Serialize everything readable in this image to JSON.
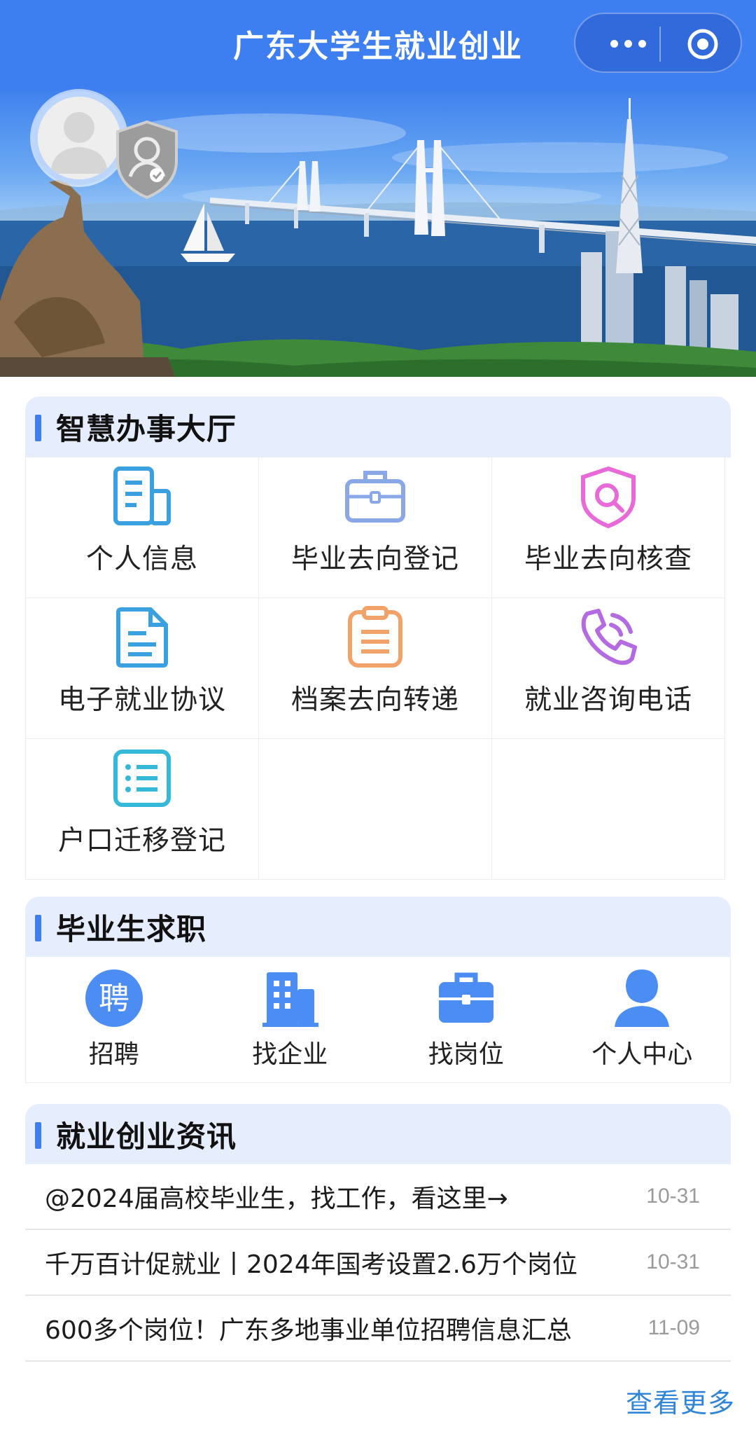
{
  "header": {
    "title": "广东大学生就业创业"
  },
  "colors": {
    "primary": "#3d7ff0",
    "section_bg": "#e6eefe",
    "link": "#2f86d8",
    "date": "#9a9a9a"
  },
  "services": {
    "title": "智慧办事大厅",
    "items": [
      {
        "label": "个人信息",
        "icon": "document-icon"
      },
      {
        "label": "毕业去向登记",
        "icon": "briefcase-icon"
      },
      {
        "label": "毕业去向核查",
        "icon": "shield-search-icon"
      },
      {
        "label": "电子就业协议",
        "icon": "file-text-icon"
      },
      {
        "label": "档案去向转递",
        "icon": "clipboard-icon"
      },
      {
        "label": "就业咨询电话",
        "icon": "phone-icon"
      },
      {
        "label": "户口迁移登记",
        "icon": "list-icon"
      }
    ]
  },
  "jobs": {
    "title": "毕业生求职",
    "items": [
      {
        "label": "招聘",
        "icon": "recruit-icon",
        "glyph": "聘"
      },
      {
        "label": "找企业",
        "icon": "building-icon"
      },
      {
        "label": "找岗位",
        "icon": "briefcase-icon"
      },
      {
        "label": "个人中心",
        "icon": "user-icon"
      }
    ]
  },
  "news": {
    "title": "就业创业资讯",
    "items": [
      {
        "title": "@2024届高校毕业生，找工作，看这里→",
        "date": "10-31"
      },
      {
        "title": "千万百计促就业丨2024年国考设置2.6万个岗位",
        "date": "10-31"
      },
      {
        "title": "600多个岗位！广东多地事业单位招聘信息汇总",
        "date": "11-09"
      }
    ],
    "more_label": "查看更多"
  }
}
